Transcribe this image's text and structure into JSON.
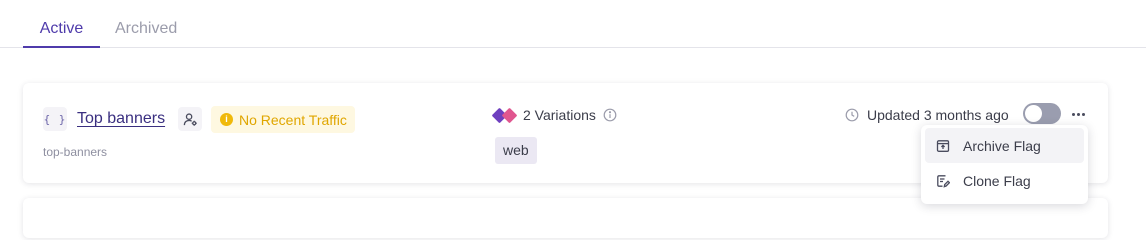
{
  "tabs": [
    {
      "label": "Active",
      "active": true
    },
    {
      "label": "Archived",
      "active": false
    }
  ],
  "flag": {
    "type_icon": "json-braces-icon",
    "type_icon_text": "{ }",
    "name": "Top banners",
    "owner_icon": "user-settings-icon",
    "traffic_status": "No Recent Traffic",
    "traffic_icon": "info-icon",
    "traffic_icon_text": "i",
    "key": "top-banners",
    "variations_label": "2 Variations",
    "variation_colors": [
      "#6e3fbf",
      "#e0568f"
    ],
    "tag": "web",
    "updated_label": "Updated 3 months ago",
    "toggle_on": false
  },
  "menu": {
    "items": [
      {
        "label": "Archive Flag",
        "icon": "archive-icon"
      },
      {
        "label": "Clone Flag",
        "icon": "clone-icon"
      }
    ]
  },
  "colors": {
    "accent": "#4f3bab",
    "warning": "#f0b90b",
    "warning_bg": "#fef8e1",
    "tag_bg": "#ebe8f3"
  }
}
